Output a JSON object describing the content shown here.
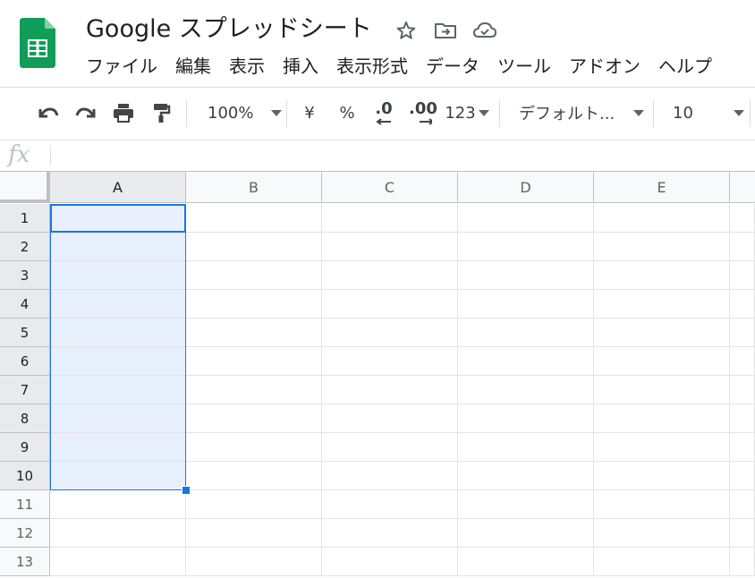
{
  "app": {
    "title": "Google スプレッドシート",
    "icons": [
      "star-icon",
      "move-to-folder-icon",
      "cloud-saved-icon"
    ]
  },
  "menu": [
    "ファイル",
    "編集",
    "表示",
    "挿入",
    "表示形式",
    "データ",
    "ツール",
    "アドオン",
    "ヘルプ"
  ],
  "toolbar": {
    "zoom": "100%",
    "currency": "¥",
    "percent": "%",
    "decrease_decimal": ".0",
    "increase_decimal": ".00",
    "number_format": "123",
    "font": "デフォルト...",
    "font_size": "10"
  },
  "formula_bar": {
    "label": "fx",
    "value": ""
  },
  "sheet": {
    "columns": [
      "A",
      "B",
      "C",
      "D",
      "E"
    ],
    "rows": [
      "1",
      "2",
      "3",
      "4",
      "5",
      "6",
      "7",
      "8",
      "9",
      "10",
      "11",
      "12",
      "13"
    ],
    "selection": "A1:A10",
    "active_cell": "A1",
    "colors": {
      "selection_fill": "#e8f0fe",
      "selection_border": "#1a73e8",
      "sheets_green": "#0f9d58"
    }
  }
}
